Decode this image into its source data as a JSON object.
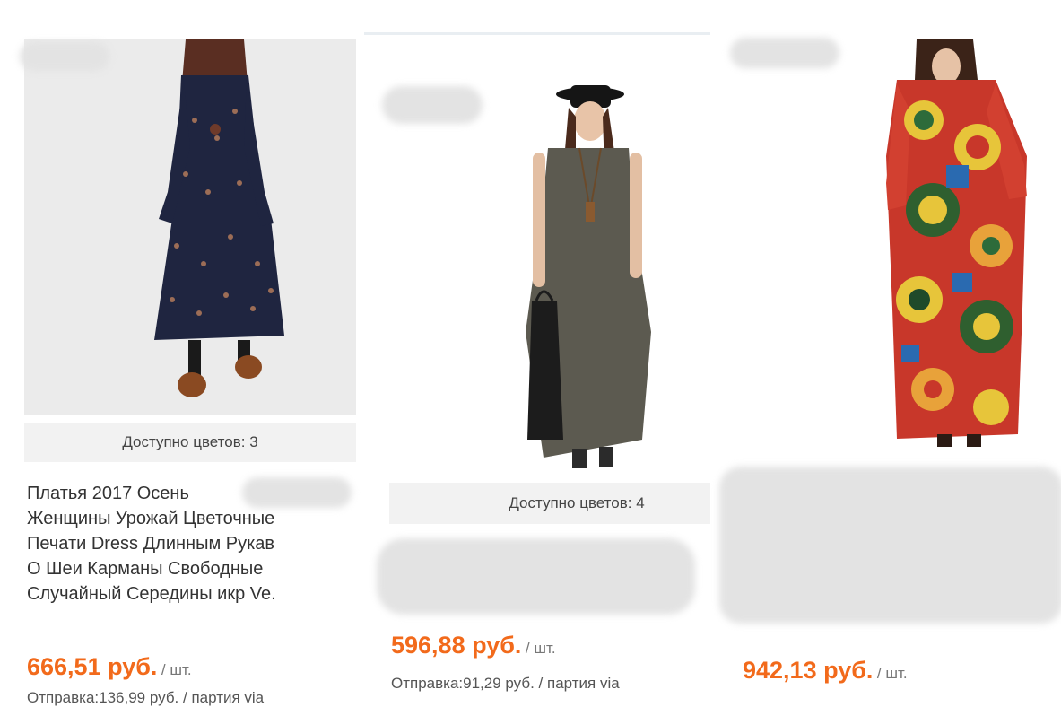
{
  "products": [
    {
      "colors_label": "Доступно цветов: 3",
      "title_lines": [
        "Платья 2017 Осень",
        "Женщины Урожай Цветочные",
        "Печати Dress Длинным Рукав",
        "О Шеи Карманы Свободные",
        "Случайный Середины икр Ve."
      ],
      "price": "666,51 руб.",
      "unit": "/ шт.",
      "shipping": "Отправка:136,99 руб. / партия via",
      "image": "dark-floral-long-sleeve-dress"
    },
    {
      "colors_label": "Доступно цветов: 4",
      "price": "596,88 руб.",
      "unit": "/ шт.",
      "shipping": "Отправка:91,29 руб. / партия via",
      "image": "grey-sleeveless-maxi-dress"
    },
    {
      "price": "942,13 руб.",
      "unit": "/ шт.",
      "image": "colorful-printed-kaftan-dress"
    }
  ],
  "colors": {
    "price": "#f26a1b",
    "colors_bar": "#f2f2f2"
  }
}
